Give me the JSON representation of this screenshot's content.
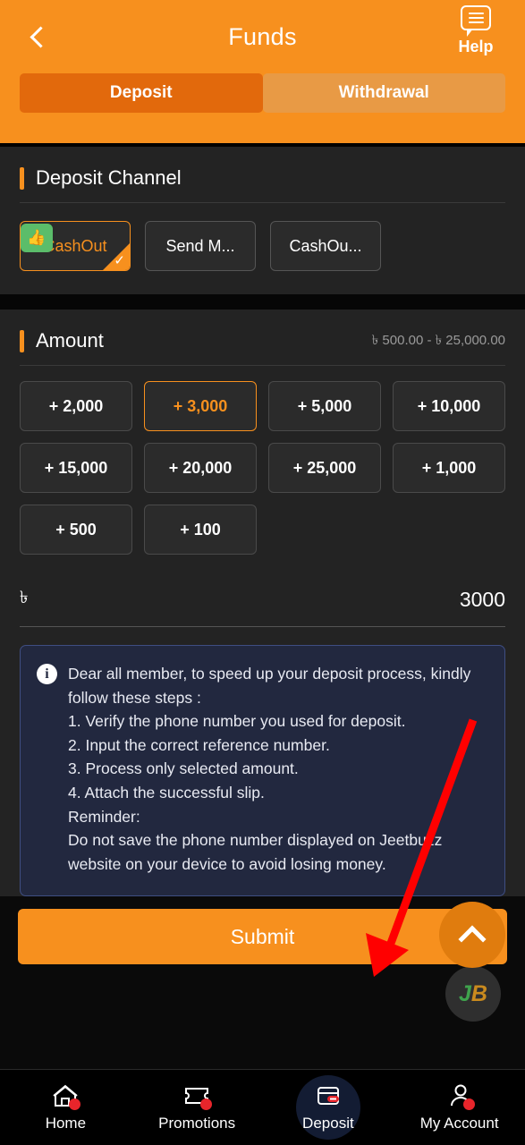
{
  "header": {
    "title": "Funds",
    "back_icon": "chevron-left-icon",
    "help_label": "Help",
    "help_icon": "speech-bubble-icon",
    "tabs": [
      {
        "label": "Deposit",
        "active": true
      },
      {
        "label": "Withdrawal",
        "active": false
      }
    ]
  },
  "deposit_channel": {
    "section_title": "Deposit Channel",
    "options": [
      {
        "label": "CashOut",
        "selected": true,
        "badge_icon": "thumbs-up-icon",
        "check_icon": "check-icon"
      },
      {
        "label": "Send M...",
        "selected": false
      },
      {
        "label": "CashOu...",
        "selected": false
      }
    ]
  },
  "amount": {
    "section_title": "Amount",
    "range_text": "৳ 500.00 - ৳ 25,000.00",
    "quick_amounts": [
      {
        "label": "+ 2,000",
        "selected": false
      },
      {
        "label": "+ 3,000",
        "selected": true
      },
      {
        "label": "+ 5,000",
        "selected": false
      },
      {
        "label": "+ 10,000",
        "selected": false
      },
      {
        "label": "+ 15,000",
        "selected": false
      },
      {
        "label": "+ 20,000",
        "selected": false
      },
      {
        "label": "+ 25,000",
        "selected": false
      },
      {
        "label": "+ 1,000",
        "selected": false
      },
      {
        "label": "+ 500",
        "selected": false
      },
      {
        "label": "+ 100",
        "selected": false
      }
    ],
    "currency_symbol": "৳",
    "input_value": "3000",
    "input_placeholder": ""
  },
  "notice": {
    "icon": "info-icon",
    "text": "Dear all member, to speed up your deposit process, kindly follow these steps :\n1. Verify the phone number you used for deposit.\n2. Input the correct reference number.\n3. Process only selected amount.\n4. Attach the successful slip.\nReminder:\nDo not save the phone number displayed on Jeetbuzz website on your device to avoid losing money."
  },
  "footer": {
    "submit_label": "Submit",
    "scroll_top_icon": "chevron-up-icon",
    "brand_initials_j": "J",
    "brand_initials_b": "B"
  },
  "bottom_nav": [
    {
      "label": "Home",
      "icon": "home-icon",
      "active": false
    },
    {
      "label": "Promotions",
      "icon": "ticket-icon",
      "active": false
    },
    {
      "label": "Deposit",
      "icon": "wallet-icon",
      "active": true
    },
    {
      "label": "My Account",
      "icon": "user-icon",
      "active": false
    }
  ],
  "annotation": {
    "type": "red-arrow",
    "color": "#FF0000",
    "points_to": "Submit"
  },
  "colors": {
    "brand_orange": "#F7901E",
    "tab_active": "#E2690C",
    "tab_inactive": "#E89A45",
    "panel": "#232323",
    "notice_bg": "#22283F",
    "accent_red": "#E8252B"
  }
}
